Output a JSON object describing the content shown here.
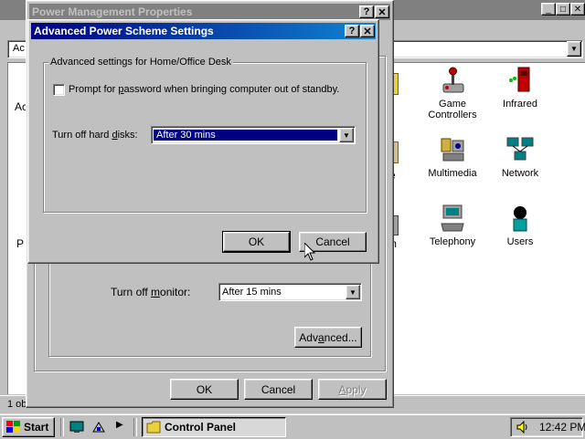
{
  "background_window": {
    "address_fragment": "Ac",
    "left_fragment_1": "Ac",
    "left_fragment_2": "P",
    "status_fragment": "1 ob",
    "icons": [
      {
        "name": "game-controllers",
        "label_line1": "Game",
        "label_line2": "Controllers"
      },
      {
        "name": "infrared",
        "label_line1": "Infrared",
        "label_line2": ""
      },
      {
        "name": "multimedia",
        "label_line1": "Multimedia",
        "label_line2": ""
      },
      {
        "name": "network",
        "label_line1": "Network",
        "label_line2": ""
      },
      {
        "name": "telephony",
        "label_line1": "Telephony",
        "label_line2": ""
      },
      {
        "name": "users",
        "label_line1": "Users",
        "label_line2": ""
      }
    ],
    "partial_icon_fragments": [
      "e",
      "e",
      "m"
    ]
  },
  "power_dialog": {
    "title": "Power Management Properties",
    "monitor_label_pre": "Turn off ",
    "monitor_label_u": "m",
    "monitor_label_post": "onitor:",
    "monitor_value": "After 15 mins",
    "advanced_pre": "Adv",
    "advanced_u": "a",
    "advanced_post": "nced...",
    "ok_label": "OK",
    "cancel_label": "Cancel",
    "apply_pre": "",
    "apply_u": "A",
    "apply_post": "pply"
  },
  "advanced_dialog": {
    "title": "Advanced Power Scheme Settings",
    "group_title": "Advanced settings for Home/Office Desk",
    "checkbox_pre": "Prompt for ",
    "checkbox_u": "p",
    "checkbox_post": "assword when bringing computer out of standby.",
    "checkbox_checked": false,
    "harddisk_pre": "Turn off hard ",
    "harddisk_u": "d",
    "harddisk_post": "isks:",
    "harddisk_value": "After 30 mins",
    "ok_label": "OK",
    "cancel_label": "Cancel"
  },
  "taskbar": {
    "start_label": "Start",
    "task_label": "Control Panel",
    "clock": "12:42 PM"
  },
  "colors": {
    "active_title_start": "#000080",
    "active_title_end": "#1084d0",
    "inactive_title": "#808080",
    "selection": "#000080"
  }
}
